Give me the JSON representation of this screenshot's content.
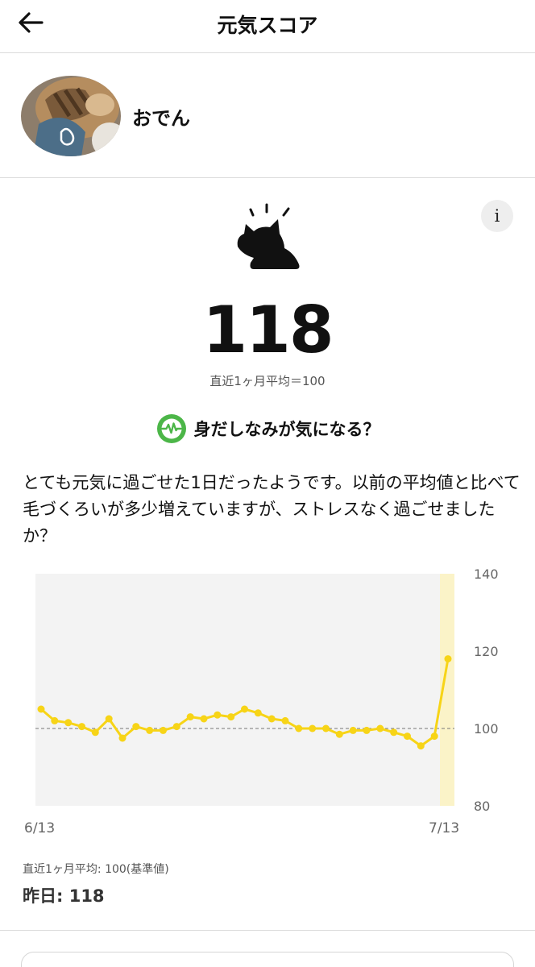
{
  "header": {
    "title": "元気スコア",
    "back_icon": "arrow-left-icon"
  },
  "profile": {
    "name": "おでん"
  },
  "score": {
    "value": "118",
    "average_text": "直近1ヶ月平均＝100",
    "mood_icon": "cat-sun-icon",
    "info_label": "i"
  },
  "insight": {
    "icon": "heartbeat-icon",
    "text": "身だしなみが気になる？",
    "icon_color": "#4CB648"
  },
  "description": "とても元気に過ごせた1日だったようです。以前の平均値と比べて毛づくろいが多少増えていますが、ストレスなく過ごせましたか？",
  "chart_data": {
    "type": "line",
    "x_labels": [
      "6/13",
      "7/13"
    ],
    "y_ticks": [
      "140",
      "120",
      "100",
      "80"
    ],
    "ylim": [
      80,
      140
    ],
    "baseline": 100,
    "values": [
      105,
      102,
      101.5,
      100.5,
      99,
      102.5,
      97.5,
      100.5,
      99.5,
      99.5,
      100.5,
      103,
      102.5,
      103.5,
      103,
      105,
      104,
      102.5,
      102,
      100,
      100,
      100,
      98.5,
      99.5,
      99.5,
      100,
      99,
      98,
      95.5,
      98,
      118
    ],
    "line_color": "#F7D417",
    "highlight_color": "#FBF3C8",
    "plot_bg": "#F3F3F3"
  },
  "footer": {
    "average_text": "直近1ヶ月平均: 100(基準値)",
    "yesterday_text": "昨日: 118"
  }
}
